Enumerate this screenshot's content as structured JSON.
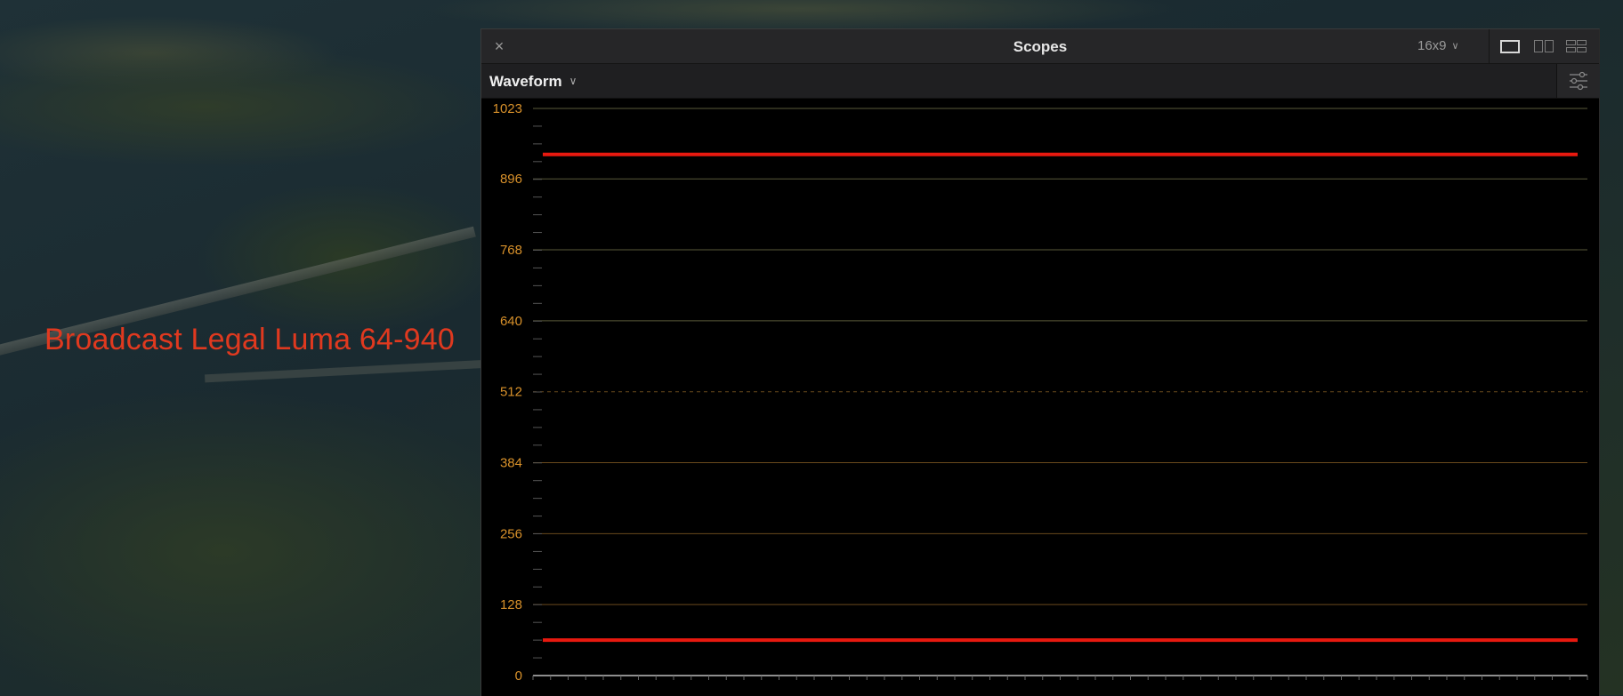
{
  "overlay": {
    "label": "Broadcast Legal Luma 64-940",
    "label_color": "#e0391f"
  },
  "window": {
    "title": "Scopes",
    "aspect_ratio": "16x9",
    "scope_type": "Waveform",
    "icons": {
      "close": "close-icon",
      "aspect_dropdown": "chevron-down-icon",
      "layout_single": "single-view-icon",
      "layout_dual": "dual-view-icon",
      "layout_quad": "quad-view-icon",
      "scope_dropdown": "chevron-down-icon",
      "settings": "sliders-icon"
    }
  },
  "chart_data": {
    "type": "line",
    "ylim": [
      0,
      1023
    ],
    "y_ticks": [
      "1023",
      "896",
      "768",
      "640",
      "512",
      "384",
      "256",
      "128",
      "0"
    ],
    "series": [
      {
        "name": "",
        "values": [
          940,
          940
        ],
        "color": "#e8190f"
      },
      {
        "name": "",
        "values": [
          64,
          64
        ],
        "color": "#e8190f"
      }
    ],
    "grid": true,
    "gridline_color": "#d7902a"
  }
}
